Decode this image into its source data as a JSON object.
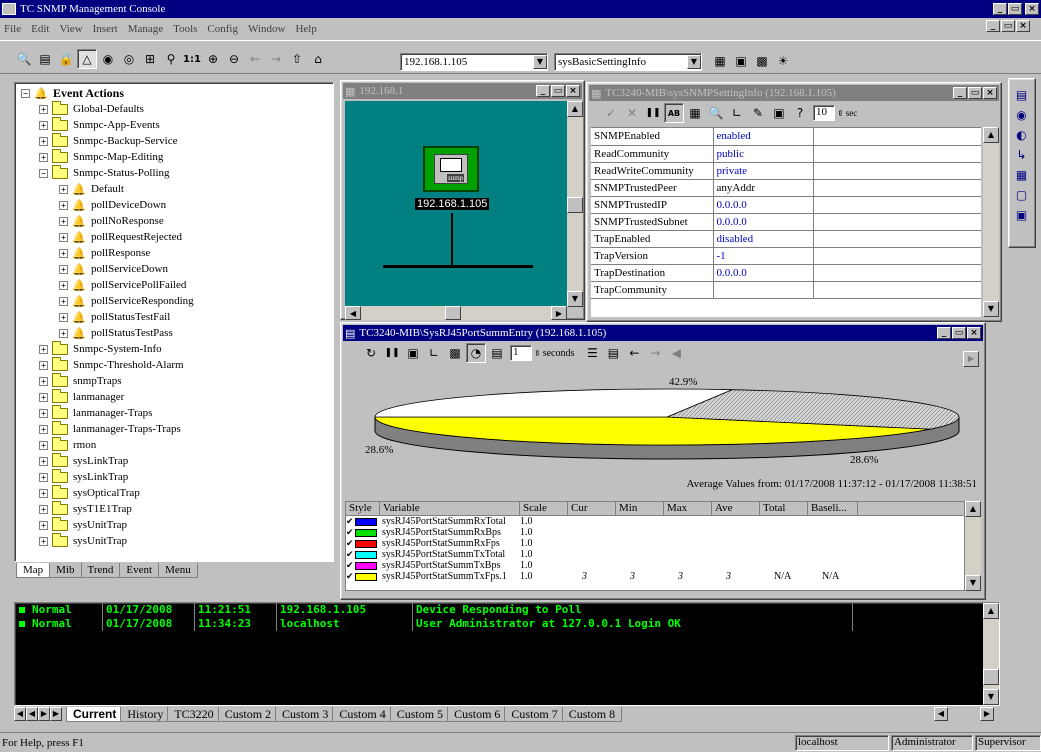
{
  "app": {
    "title": "TC SNMP Management Console"
  },
  "menu": [
    "File",
    "Edit",
    "View",
    "Insert",
    "Manage",
    "Tools",
    "Config",
    "Window",
    "Help"
  ],
  "toolbar": {
    "address": "192.168.1.105",
    "mib_group": "sysBasicSettingInfo"
  },
  "tree": {
    "root": "Event Actions",
    "items": [
      {
        "label": "Global-Defaults",
        "type": "folder",
        "level": 1
      },
      {
        "label": "Snmpc-App-Events",
        "type": "folder",
        "level": 1
      },
      {
        "label": "Snmpc-Backup-Service",
        "type": "folder",
        "level": 1
      },
      {
        "label": "Snmpc-Map-Editing",
        "type": "folder",
        "level": 1
      },
      {
        "label": "Snmpc-Status-Polling",
        "type": "folder",
        "level": 1,
        "open": true
      },
      {
        "label": "Default",
        "type": "bell",
        "level": 2
      },
      {
        "label": "pollDeviceDown",
        "type": "bell",
        "level": 2
      },
      {
        "label": "pollNoResponse",
        "type": "bell",
        "level": 2
      },
      {
        "label": "pollRequestRejected",
        "type": "bell",
        "level": 2
      },
      {
        "label": "pollResponse",
        "type": "bell",
        "level": 2
      },
      {
        "label": "pollServiceDown",
        "type": "bell",
        "level": 2
      },
      {
        "label": "pollServicePollFailed",
        "type": "bell",
        "level": 2
      },
      {
        "label": "pollServiceResponding",
        "type": "bell",
        "level": 2
      },
      {
        "label": "pollStatusTestFail",
        "type": "bell",
        "level": 2
      },
      {
        "label": "pollStatusTestPass",
        "type": "bell",
        "level": 2
      },
      {
        "label": "Snmpc-System-Info",
        "type": "folder",
        "level": 1
      },
      {
        "label": "Snmpc-Threshold-Alarm",
        "type": "folder",
        "level": 1
      },
      {
        "label": "snmpTraps",
        "type": "folder",
        "level": 1
      },
      {
        "label": "lanmanager",
        "type": "folder",
        "level": 1
      },
      {
        "label": "lanmanager-Traps",
        "type": "folder",
        "level": 1
      },
      {
        "label": "lanmanager-Traps-Traps",
        "type": "folder",
        "level": 1
      },
      {
        "label": "rmon",
        "type": "folder",
        "level": 1
      },
      {
        "label": "sysLinkTrap",
        "type": "folder",
        "level": 1
      },
      {
        "label": "sysLinkTrap",
        "type": "folder",
        "level": 1
      },
      {
        "label": "sysOpticalTrap",
        "type": "folder",
        "level": 1
      },
      {
        "label": "sysT1E1Trap",
        "type": "folder",
        "level": 1
      },
      {
        "label": "sysUnitTrap",
        "type": "folder",
        "level": 1
      },
      {
        "label": "sysUnitTrap",
        "type": "folder",
        "level": 1
      }
    ]
  },
  "tree_tabs": [
    "Map",
    "Mib",
    "Trend",
    "Event",
    "Menu"
  ],
  "map_window": {
    "title": "192.168.1",
    "device_label": "192.168.1.105",
    "device_icon_label": "snmp"
  },
  "mib_window": {
    "title": "TC3240-MIB\\sysSNMPSettingInfo (192.168.1.105)",
    "interval": "10",
    "interval_unit": "sec",
    "rows": [
      {
        "k": "SNMPEnabled",
        "v": "enabled"
      },
      {
        "k": "ReadCommunity",
        "v": "public"
      },
      {
        "k": "ReadWriteCommunity",
        "v": "private"
      },
      {
        "k": "SNMPTrustedPeer",
        "v": "anyAddr"
      },
      {
        "k": "SNMPTrustedIP",
        "v": "0.0.0.0"
      },
      {
        "k": "SNMPTrustedSubnet",
        "v": "0.0.0.0"
      },
      {
        "k": "TrapEnabled",
        "v": "disabled"
      },
      {
        "k": "TrapVersion",
        "v": "-1"
      },
      {
        "k": "TrapDestination",
        "v": "0.0.0.0"
      },
      {
        "k": "TrapCommunity",
        "v": ""
      }
    ]
  },
  "chart_window": {
    "title": "TC3240-MIB\\SysRJ45PortSummEntry (192.168.1.105)",
    "interval": "1",
    "interval_unit": "seconds",
    "average_text": "Average Values from: 01/17/2008 11:37:12 - 01/17/2008 11:38:51",
    "columns": [
      "Style",
      "Variable",
      "Scale",
      "Cur",
      "Min",
      "Max",
      "Ave",
      "Total",
      "Baseli..."
    ],
    "series": [
      {
        "name": "sysRJ45PortStatSummRxTotal",
        "scale": "1.0",
        "color": "#0000ff",
        "cur": "",
        "min": "",
        "max": "",
        "ave": "",
        "total": "",
        "base": ""
      },
      {
        "name": "sysRJ45PortStatSummRxBps",
        "scale": "1.0",
        "color": "#00e000",
        "cur": "",
        "min": "",
        "max": "",
        "ave": "",
        "total": "",
        "base": ""
      },
      {
        "name": "sysRJ45PortStatSummRxFps",
        "scale": "1.0",
        "color": "#ff0000",
        "cur": "",
        "min": "",
        "max": "",
        "ave": "",
        "total": "",
        "base": ""
      },
      {
        "name": "sysRJ45PortStatSummTxTotal",
        "scale": "1.0",
        "color": "#00ffff",
        "cur": "",
        "min": "",
        "max": "",
        "ave": "",
        "total": "",
        "base": ""
      },
      {
        "name": "sysRJ45PortStatSummTxBps",
        "scale": "1.0",
        "color": "#ff00ff",
        "cur": "",
        "min": "",
        "max": "",
        "ave": "",
        "total": "",
        "base": ""
      },
      {
        "name": "sysRJ45PortStatSummTxFps.1",
        "scale": "1.0",
        "color": "#ffff00",
        "cur": "3",
        "min": "3",
        "max": "3",
        "ave": "3",
        "total": "N/A",
        "base": "N/A"
      }
    ]
  },
  "chart_data": {
    "type": "pie",
    "slices": [
      {
        "label": "42.9%",
        "value": 42.9,
        "color": "#ffff00"
      },
      {
        "label": "28.6%",
        "value": 28.6,
        "color": "#ffffff"
      },
      {
        "label": "28.6%",
        "value": 28.6,
        "color": "#c0c0c0"
      }
    ]
  },
  "events": [
    {
      "severity": "Normal",
      "date": "01/17/2008",
      "time": "11:21:51",
      "source": "192.168.1.105",
      "message": "Device Responding to Poll"
    },
    {
      "severity": "Normal",
      "date": "01/17/2008",
      "time": "11:34:23",
      "source": "localhost",
      "message": "User Administrator at 127.0.0.1 Login OK"
    }
  ],
  "event_tabs": [
    "Current",
    "History",
    "TC3220",
    "Custom 2",
    "Custom 3",
    "Custom 4",
    "Custom 5",
    "Custom 6",
    "Custom 7",
    "Custom 8"
  ],
  "status": {
    "help": "For Help, press F1",
    "host": "localhost",
    "user": "Administrator",
    "role": "Supervisor"
  }
}
